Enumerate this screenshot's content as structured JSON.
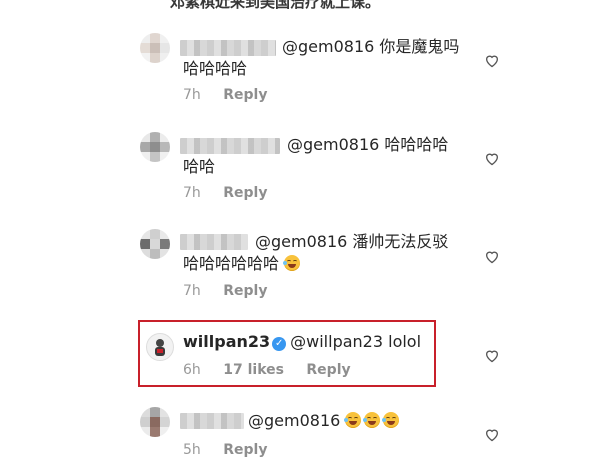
{
  "top_caption": "邓紫棋近来到美国治疗就上课。",
  "comments": [
    {
      "mention": "@gem0816",
      "text_line1": " 你是魔鬼吗",
      "text_line2": "哈哈哈哈",
      "time": "7h",
      "reply": "Reply"
    },
    {
      "mention": "@gem0816",
      "text_line1": " 哈哈哈哈",
      "text_line2": "哈哈",
      "time": "7h",
      "reply": "Reply"
    },
    {
      "mention": "@gem0816",
      "text_line1": " 潘帅无法反驳",
      "text_line2": "哈哈哈哈哈哈",
      "time": "7h",
      "reply": "Reply"
    },
    {
      "username": "willpan23",
      "mention": "@willpan23",
      "text_line1": " lolol",
      "time": "6h",
      "likes": "17 likes",
      "reply": "Reply"
    },
    {
      "mention": "@gem0816",
      "text_line1": " ",
      "time": "5h",
      "reply": "Reply"
    }
  ],
  "colors": {
    "highlight_border": "#c8202a",
    "verified": "#3897f0",
    "meta_text": "#999999"
  },
  "icons": {
    "like": "heart-outline-icon",
    "verified": "verified-badge-icon",
    "emoji": "crying-laughing-emoji"
  }
}
